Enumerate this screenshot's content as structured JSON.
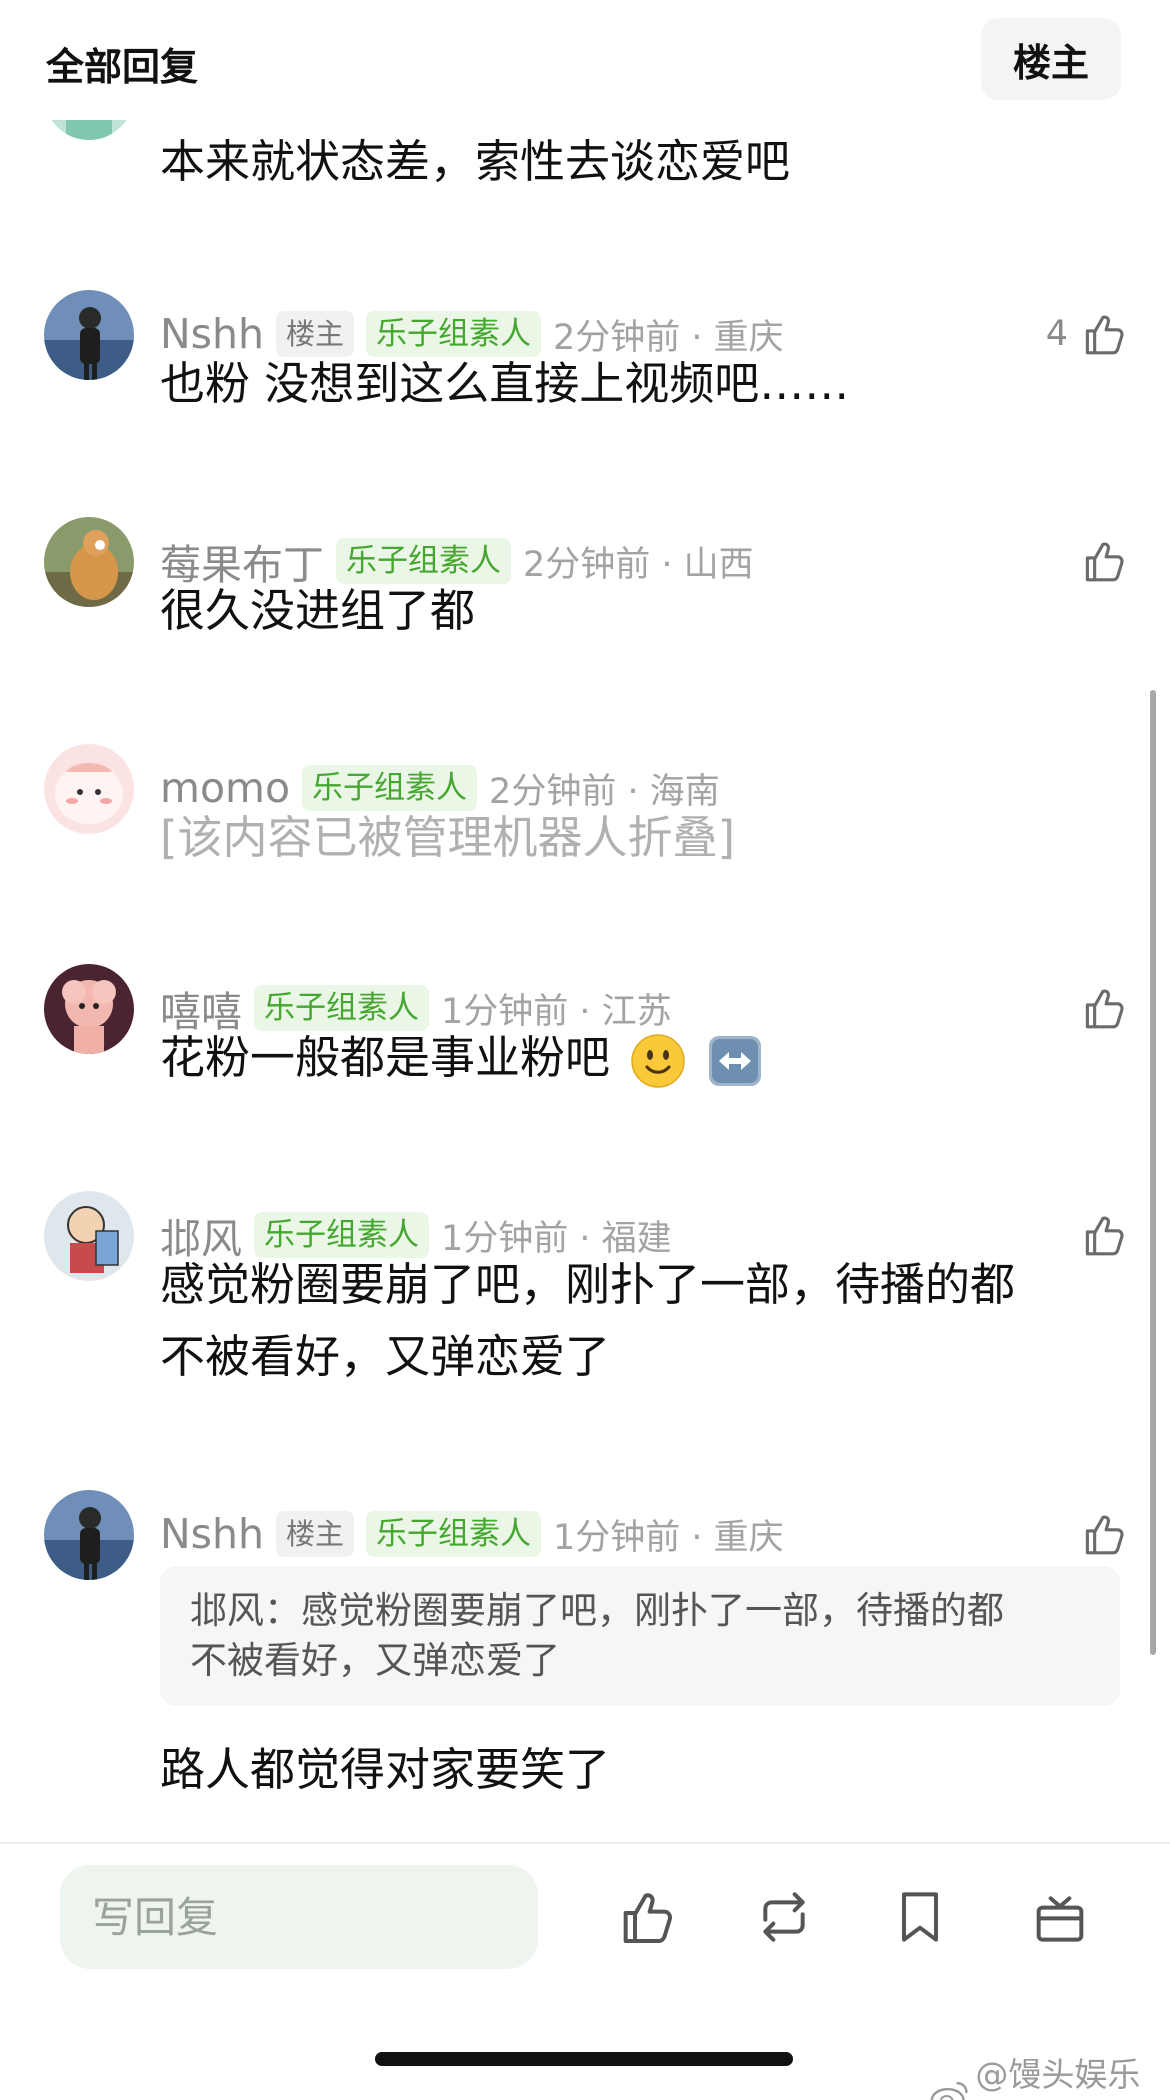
{
  "header": {
    "title": "全部回复",
    "op_button": "楼主"
  },
  "partial_comment": {
    "text": "本来就状态差，索性去谈恋爱吧"
  },
  "comments": [
    {
      "username": "Nshh",
      "op_tag": "楼主",
      "group_tag": "乐子组素人",
      "time": "2分钟前 · 重庆",
      "likes": "4",
      "text": "也粉 没想到这么直接上视频吧……"
    },
    {
      "username": "莓果布丁",
      "group_tag": "乐子组素人",
      "time": "2分钟前 · 山西",
      "text": "很久没进组了都"
    },
    {
      "username": "momo",
      "group_tag": "乐子组素人",
      "time": "2分钟前 · 海南",
      "text": "[该内容已被管理机器人折叠]"
    },
    {
      "username": "嘻嘻",
      "group_tag": "乐子组素人",
      "time": "1分钟前 · 江苏",
      "text": "花粉一般都是事业粉吧",
      "emojis": [
        "slightly-smiling-face",
        "left-right-arrow"
      ]
    },
    {
      "username": "邶风",
      "group_tag": "乐子组素人",
      "time": "1分钟前 · 福建",
      "text_line1": "感觉粉圈要崩了吧，刚扑了一部，待播的都",
      "text_line2": "不被看好，又弹恋爱了"
    },
    {
      "username": "Nshh",
      "op_tag": "楼主",
      "group_tag": "乐子组素人",
      "time": "1分钟前 · 重庆",
      "quote_line1": "邶风：感觉粉圈要崩了吧，刚扑了一部，待播的都",
      "quote_line2": "不被看好，又弹恋爱了",
      "text": "路人都觉得对家要笑了"
    }
  ],
  "bottom_bar": {
    "reply_placeholder": "写回复",
    "icons": [
      "like-icon",
      "repost-icon",
      "bookmark-icon",
      "gift-icon"
    ]
  },
  "watermark": "@馒头娱乐酱",
  "colors": {
    "group_tag_text": "#45a72f",
    "group_tag_bg": "#ebf7e6",
    "reply_bg": "#eef4ee"
  }
}
